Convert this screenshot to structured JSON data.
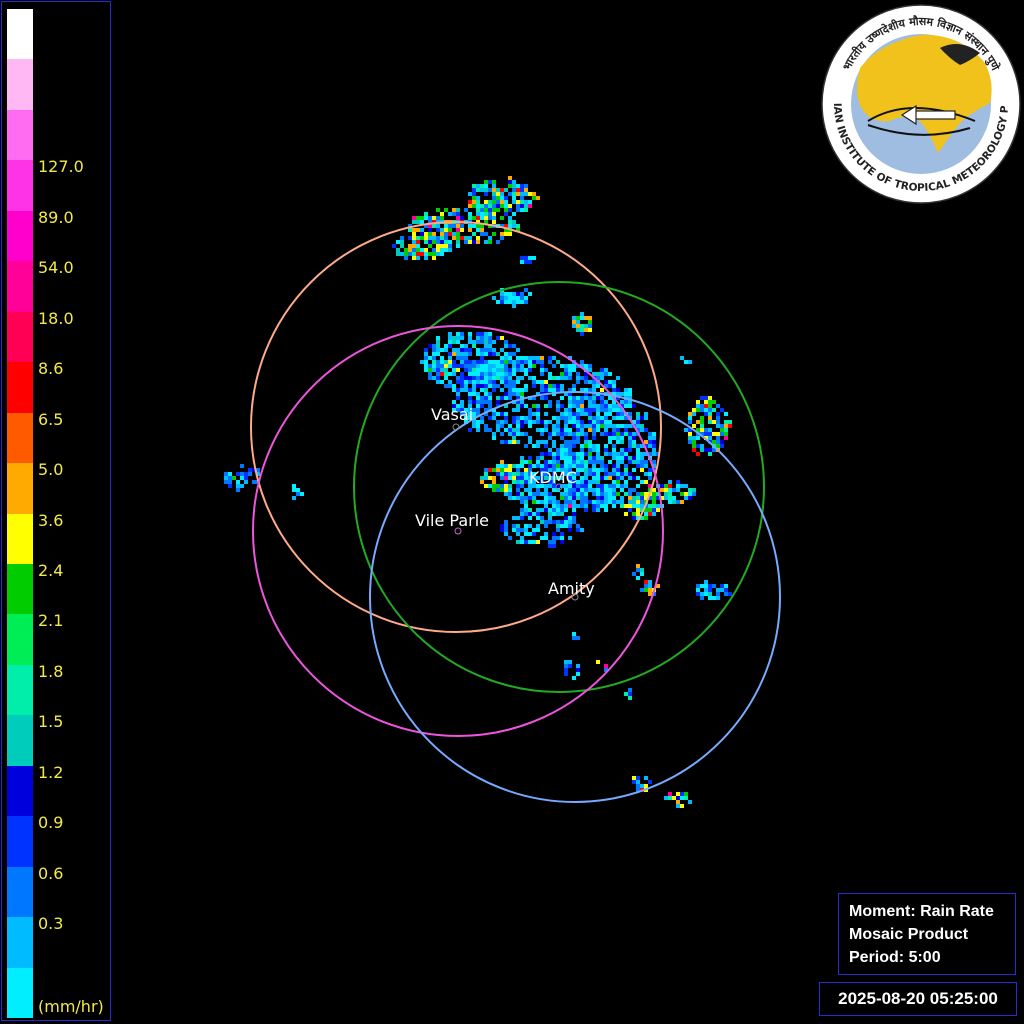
{
  "legend": {
    "ticks": [
      "127.0",
      "89.0",
      "54.0",
      "18.0",
      "8.6",
      "6.5",
      "5.0",
      "3.6",
      "2.4",
      "2.1",
      "1.8",
      "1.5",
      "1.2",
      "0.9",
      "0.6",
      "0.3"
    ],
    "unit": "(mm/hr)",
    "colors": [
      "#ffffff",
      "#ffb8f4",
      "#ff6cf2",
      "#ff33e6",
      "#ff00cc",
      "#ff0099",
      "#ff0055",
      "#ff0000",
      "#ff5a00",
      "#ffaa00",
      "#ffff00",
      "#00cc00",
      "#00ee55",
      "#00eeaa",
      "#00ccbb",
      "#0000dd",
      "#0033ff",
      "#0077ff",
      "#00bbff",
      "#00eeff"
    ]
  },
  "sites": [
    {
      "name": "Vasai",
      "ring_color": "#ffaa88"
    },
    {
      "name": "KDMC",
      "ring_color": "#22aa22"
    },
    {
      "name": "Vile Parle",
      "ring_color": "#ee55dd"
    },
    {
      "name": "Amity",
      "ring_color": "#77aaff"
    }
  ],
  "info": {
    "moment": "Moment: Rain Rate",
    "product": "Mosaic Product",
    "period": "Period: 5:00"
  },
  "timestamp": "2025-08-20 05:25:00",
  "logo": {
    "text_hindi": "भारतीय उष्णदेशीय मौसम विज्ञान संस्थान पुणे",
    "text_english": "INDIAN INSTITUTE OF TROPICAL METEOROLOGY PUNE"
  }
}
